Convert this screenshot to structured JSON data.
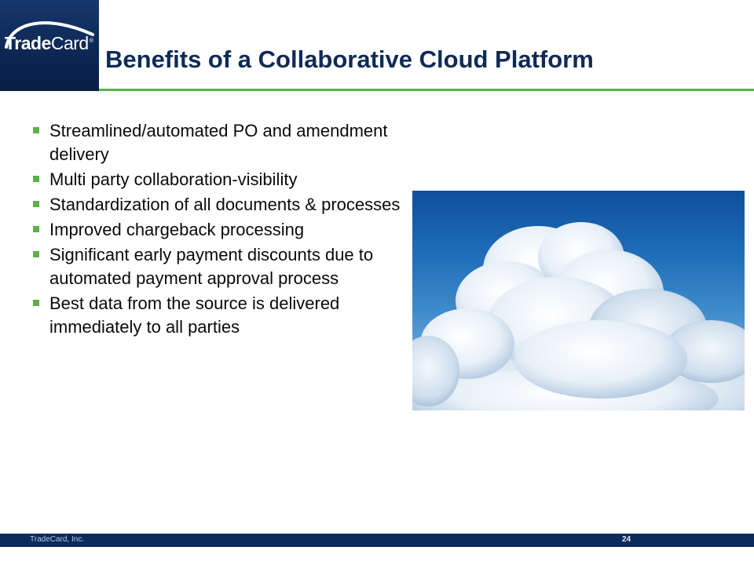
{
  "header": {
    "logo": {
      "part1": "Trade",
      "part2": "Card",
      "registered": "®"
    },
    "title": "Benefits of a Collaborative Cloud Platform",
    "accent_color": "#5cb04a",
    "brand_color": "#0b2a5c"
  },
  "bullets": [
    {
      "text": "Streamlined/automated PO and amendment delivery"
    },
    {
      "text": "Multi party collaboration-visibility"
    },
    {
      "text": "Standardization of all documents & processes"
    },
    {
      "text": "Improved chargeback processing"
    },
    {
      "text": "Significant early payment discounts due to automated payment approval process"
    },
    {
      "text": "Best data from the source is delivered immediately to all parties"
    }
  ],
  "image": {
    "icon": "cloud-photo"
  },
  "footer": {
    "company": "TradeCard,  Inc.",
    "page_number": "24"
  }
}
